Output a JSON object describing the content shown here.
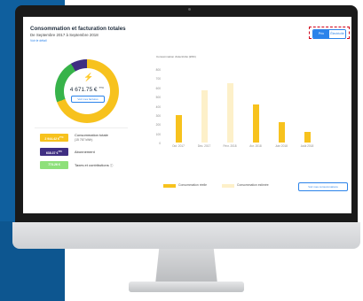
{
  "header": {
    "title": "Consommation et facturation totales",
    "subtitle": "De Septembre 2017 à Septembre 2018",
    "link": "Voir le détail"
  },
  "toggle": {
    "left": "Prix",
    "right": "Électricité"
  },
  "summary": {
    "total": "4 671.75 €",
    "total_sup": "TTC",
    "invoices_button": "Voir mes factures"
  },
  "legend_items": [
    {
      "value": "2 944.42 €",
      "sup": "TTC",
      "label": "Consommation totale",
      "sub": "(15 767 kWh)"
    },
    {
      "value": "638.37 €",
      "sup": "TTC",
      "label": "Abonnement",
      "sub": ""
    },
    {
      "value": "773.26 €",
      "sup": "",
      "label": "Taxes et contributions",
      "sub": ""
    }
  ],
  "chart_data": {
    "type": "bar",
    "title": "",
    "ylabel": "Consommation d'électricité (kWh)",
    "yticks": [
      "800",
      "700",
      "600",
      "500",
      "400",
      "300",
      "200",
      "100",
      "0"
    ],
    "categories": [
      "Oct. 2017",
      "Déc. 2017",
      "Févr. 2018",
      "Avr. 2018",
      "Juin 2018",
      "Août 2018"
    ],
    "series": [
      {
        "name": "Consommation réelle",
        "values": [
          300,
          0,
          0,
          410,
          220,
          120
        ]
      },
      {
        "name": "Consommation estimée",
        "values": [
          0,
          570,
          650,
          0,
          0,
          0
        ]
      }
    ],
    "ylim": [
      0,
      800
    ]
  },
  "chart_legend": {
    "real": "Consommation réelle",
    "estimated": "Consommation estimée",
    "button": "Voir mes consommations"
  },
  "colors": {
    "real": "#f7c21d",
    "estimated": "#fdf0c9",
    "accent": "#2b83ea",
    "pill1": "#f7c21d",
    "pill2": "#3f2e82",
    "pill3": "#8ee07a"
  }
}
